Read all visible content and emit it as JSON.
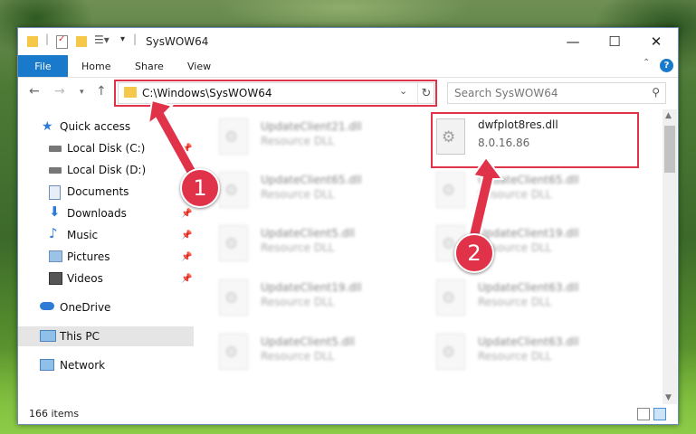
{
  "window": {
    "title": "SysWOW64"
  },
  "ribbon": {
    "file": "File",
    "home": "Home",
    "share": "Share",
    "view": "View",
    "help": "?"
  },
  "address": {
    "path": "C:\\Windows\\SysWOW64"
  },
  "search": {
    "placeholder": "Search SysWOW64"
  },
  "sidebar": {
    "items": [
      {
        "label": "Quick access"
      },
      {
        "label": "Local Disk (C:)"
      },
      {
        "label": "Local Disk (D:)"
      },
      {
        "label": "Documents"
      },
      {
        "label": "Downloads"
      },
      {
        "label": "Music"
      },
      {
        "label": "Pictures"
      },
      {
        "label": "Videos"
      },
      {
        "label": "OneDrive"
      },
      {
        "label": "This PC"
      },
      {
        "label": "Network"
      }
    ]
  },
  "files": {
    "highlighted": {
      "name": "dwfplot8res.dll",
      "version": "8.0.16.86"
    },
    "left": [
      {
        "name": "UpdateClient21.dll",
        "type": "Resource DLL"
      },
      {
        "name": "UpdateClient65.dll",
        "type": "Resource DLL"
      },
      {
        "name": "UpdateClient5.dll",
        "type": "Resource DLL"
      },
      {
        "name": "UpdateClient19.dll",
        "type": "Resource DLL"
      },
      {
        "name": "UpdateClient5.dll",
        "type": "Resource DLL"
      }
    ],
    "right": [
      {
        "name": "UpdateClient65.dll",
        "type": "Resource DLL"
      },
      {
        "name": "UpdateClient19.dll",
        "type": "Resource DLL"
      },
      {
        "name": "UpdateClient63.dll",
        "type": "Resource DLL"
      },
      {
        "name": "UpdateClient63.dll",
        "type": "Resource DLL"
      }
    ]
  },
  "status": {
    "count": "166 items"
  },
  "annotations": {
    "step1": "1",
    "step2": "2",
    "color": "#e0334a"
  }
}
